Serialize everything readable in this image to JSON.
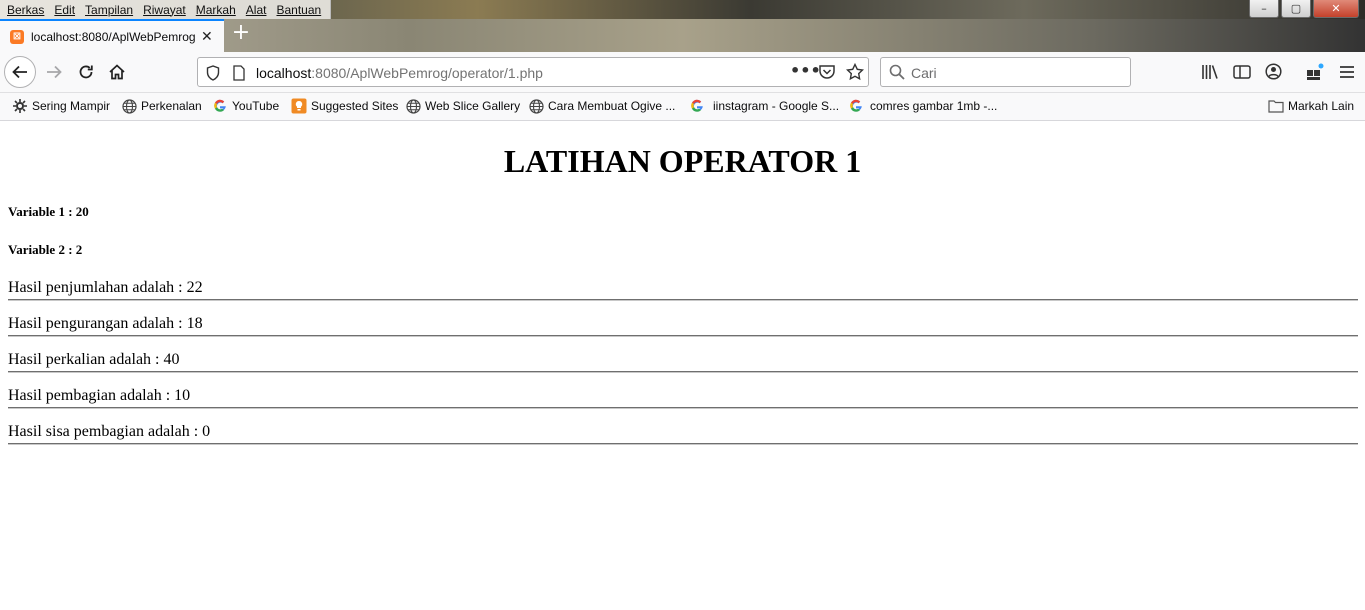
{
  "menu": [
    "Berkas",
    "Edit",
    "Tampilan",
    "Riwayat",
    "Markah",
    "Alat",
    "Bantuan"
  ],
  "tab": {
    "title": "localhost:8080/AplWebPemrog"
  },
  "url": {
    "host": "localhost",
    "rest": ":8080/AplWebPemrog/operator/1.php"
  },
  "search": {
    "placeholder": "Cari"
  },
  "bookmarks": [
    {
      "label": "Sering Mampir",
      "icon": "gear-icon"
    },
    {
      "label": "Perkenalan",
      "icon": "globe-icon"
    },
    {
      "label": "YouTube",
      "icon": "google-icon"
    },
    {
      "label": "Suggested Sites",
      "icon": "suggested-icon"
    },
    {
      "label": "Web Slice Gallery",
      "icon": "globe-icon"
    },
    {
      "label": "Cara Membuat Ogive ...",
      "icon": "globe-icon"
    },
    {
      "label": "iinstagram - Google S...",
      "icon": "google-icon"
    },
    {
      "label": "comres gambar 1mb -...",
      "icon": "google-icon"
    }
  ],
  "other_bookmarks": "Markah Lain",
  "page": {
    "title": "LATIHAN OPERATOR 1",
    "var1": "Variable 1 : 20",
    "var2": "Variable 2 : 2",
    "results": [
      "Hasil penjumlahan adalah : 22",
      "Hasil pengurangan adalah : 18",
      "Hasil perkalian adalah : 40",
      "Hasil pembagian adalah : 10",
      "Hasil sisa pembagian adalah : 0"
    ]
  },
  "colors": {
    "accent": "#0a84ff",
    "favicon": "#fb7a24"
  }
}
